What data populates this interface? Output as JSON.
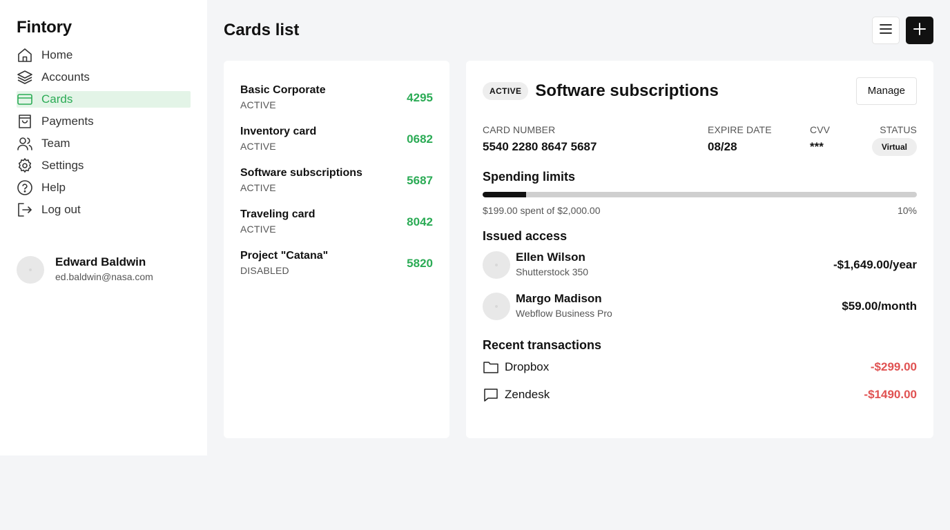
{
  "brand": "Fintory",
  "nav": [
    {
      "label": "Home",
      "icon": "home-icon"
    },
    {
      "label": "Accounts",
      "icon": "layers-icon"
    },
    {
      "label": "Cards",
      "icon": "credit-card-icon",
      "active": true
    },
    {
      "label": "Payments",
      "icon": "shopping-bag-icon"
    },
    {
      "label": "Team",
      "icon": "users-icon"
    },
    {
      "label": "Settings",
      "icon": "gear-icon"
    },
    {
      "label": "Help",
      "icon": "help-circle-icon"
    },
    {
      "label": "Log out",
      "icon": "logout-icon"
    }
  ],
  "user": {
    "name": "Edward Baldwin",
    "email": "ed.baldwin@nasa.com"
  },
  "page_title": "Cards list",
  "cards": [
    {
      "name": "Basic Corporate",
      "status": "ACTIVE",
      "last4": "4295"
    },
    {
      "name": "Inventory card",
      "status": "ACTIVE",
      "last4": "0682"
    },
    {
      "name": "Software subscriptions",
      "status": "ACTIVE",
      "last4": "5687"
    },
    {
      "name": "Traveling card",
      "status": "ACTIVE",
      "last4": "8042"
    },
    {
      "name": "Project \"Catana\"",
      "status": "DISABLED",
      "last4": "5820"
    }
  ],
  "detail": {
    "badge": "ACTIVE",
    "title": "Software subscriptions",
    "manage_label": "Manage",
    "card_number_label": "CARD NUMBER",
    "card_number": "5540 2280 8647 5687",
    "expire_label": "EXPIRE DATE",
    "expire": "08/28",
    "cvv_label": "CVV",
    "cvv": "***",
    "status_label": "STATUS",
    "status": "Virtual",
    "spending_title": "Spending limits",
    "spent_text": "$199.00 spent of $2,000.00",
    "spent_percent_text": "10%",
    "spent_fraction": 0.1,
    "access_title": "Issued access",
    "access": [
      {
        "name": "Ellen Wilson",
        "sub": "Shutterstock 350",
        "amount": "-$1,649.00/year"
      },
      {
        "name": "Margo Madison",
        "sub": "Webflow Business Pro",
        "amount": "$59.00/month"
      }
    ],
    "tx_title": "Recent transactions",
    "transactions": [
      {
        "name": "Dropbox",
        "amount": "-$299.00",
        "icon": "folder-icon"
      },
      {
        "name": "Zendesk",
        "amount": "-$1490.00",
        "icon": "message-square-icon"
      }
    ]
  },
  "colors": {
    "accent": "#2bab55",
    "accent_bg": "#e3f4e7",
    "negative": "#e05252",
    "dark": "#111111"
  }
}
